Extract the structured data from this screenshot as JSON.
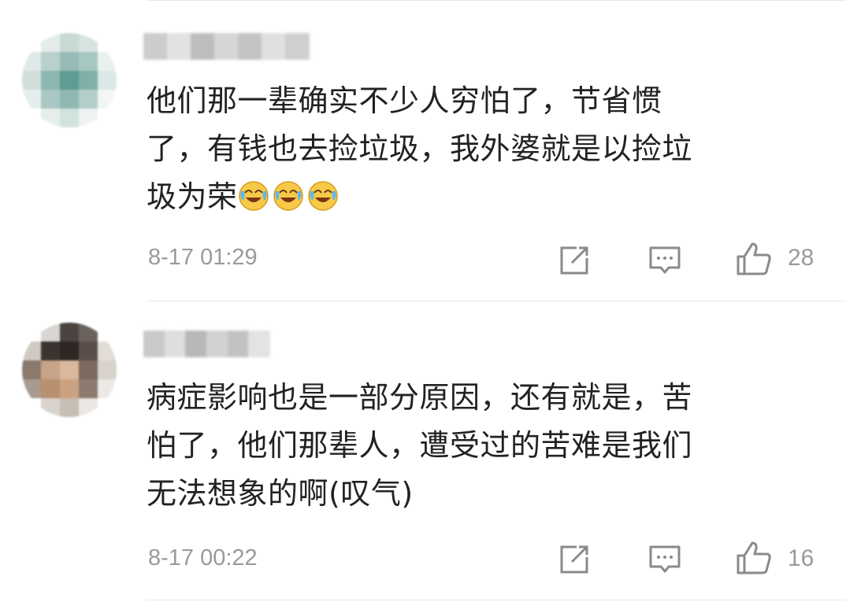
{
  "comments": [
    {
      "text_lines": [
        "他们那一辈确实不少人穷怕了，节省惯",
        "了，有钱也去捡垃圾，我外婆就是以捡垃",
        "圾为荣"
      ],
      "emoji": [
        "crying-laughing-emoji",
        "crying-laughing-emoji",
        "crying-laughing-emoji"
      ],
      "time": "8-17 01:29",
      "likes": "28",
      "avatar_colors": [
        "#ffffff",
        "#e3ecea",
        "#c8d9d6",
        "#d6e4e1",
        "#ffffff",
        "#dfe9e7",
        "#b9d1cc",
        "#97bbb6",
        "#a7c7c2",
        "#e9f1ef",
        "#cfe0dc",
        "#8db7b1",
        "#5e9c95",
        "#7fb0a9",
        "#dce8e5",
        "#e4eeec",
        "#a9c8c3",
        "#8fb9b2",
        "#b3cec9",
        "#f2f6f5",
        "#ffffff",
        "#e6eeec",
        "#d2e2df",
        "#eef3f2",
        "#ffffff"
      ],
      "username_blocks": [
        "#cccccc",
        "#e2e2e2",
        "#bdbdbd",
        "#d6d6d6",
        "#c4c4c4",
        "#e0e0e0",
        "#cfcfcf"
      ]
    },
    {
      "text_lines": [
        "病症影响也是一部分原因，还有就是，苦",
        "怕了，他们那辈人，遭受过的苦难是我们",
        "无法想象的啊(叹气)"
      ],
      "time": "8-17 00:22",
      "likes": "16",
      "avatar_colors": [
        "#ffffff",
        "#d9d6d2",
        "#4a4440",
        "#6b625c",
        "#ffffff",
        "#cfc9c3",
        "#3a332f",
        "#2d2724",
        "#5a4f48",
        "#e2ddd8",
        "#8a7a6e",
        "#c7a487",
        "#d9b89c",
        "#7b6a5d",
        "#d8d2cc",
        "#a89a8f",
        "#b7906f",
        "#caa282",
        "#8c7b6e",
        "#ede9e6",
        "#ffffff",
        "#d9d3cd",
        "#c6bdb4",
        "#ebe7e3",
        "#ffffff"
      ],
      "username_blocks": [
        "#c9c9c9",
        "#dedede",
        "#b8b8b8",
        "#d2d2d2",
        "#c2c2c2",
        "#e3e3e3"
      ]
    }
  ],
  "icons": {
    "share": "share-icon",
    "reply": "comment-icon",
    "like": "thumbs-up-icon"
  }
}
